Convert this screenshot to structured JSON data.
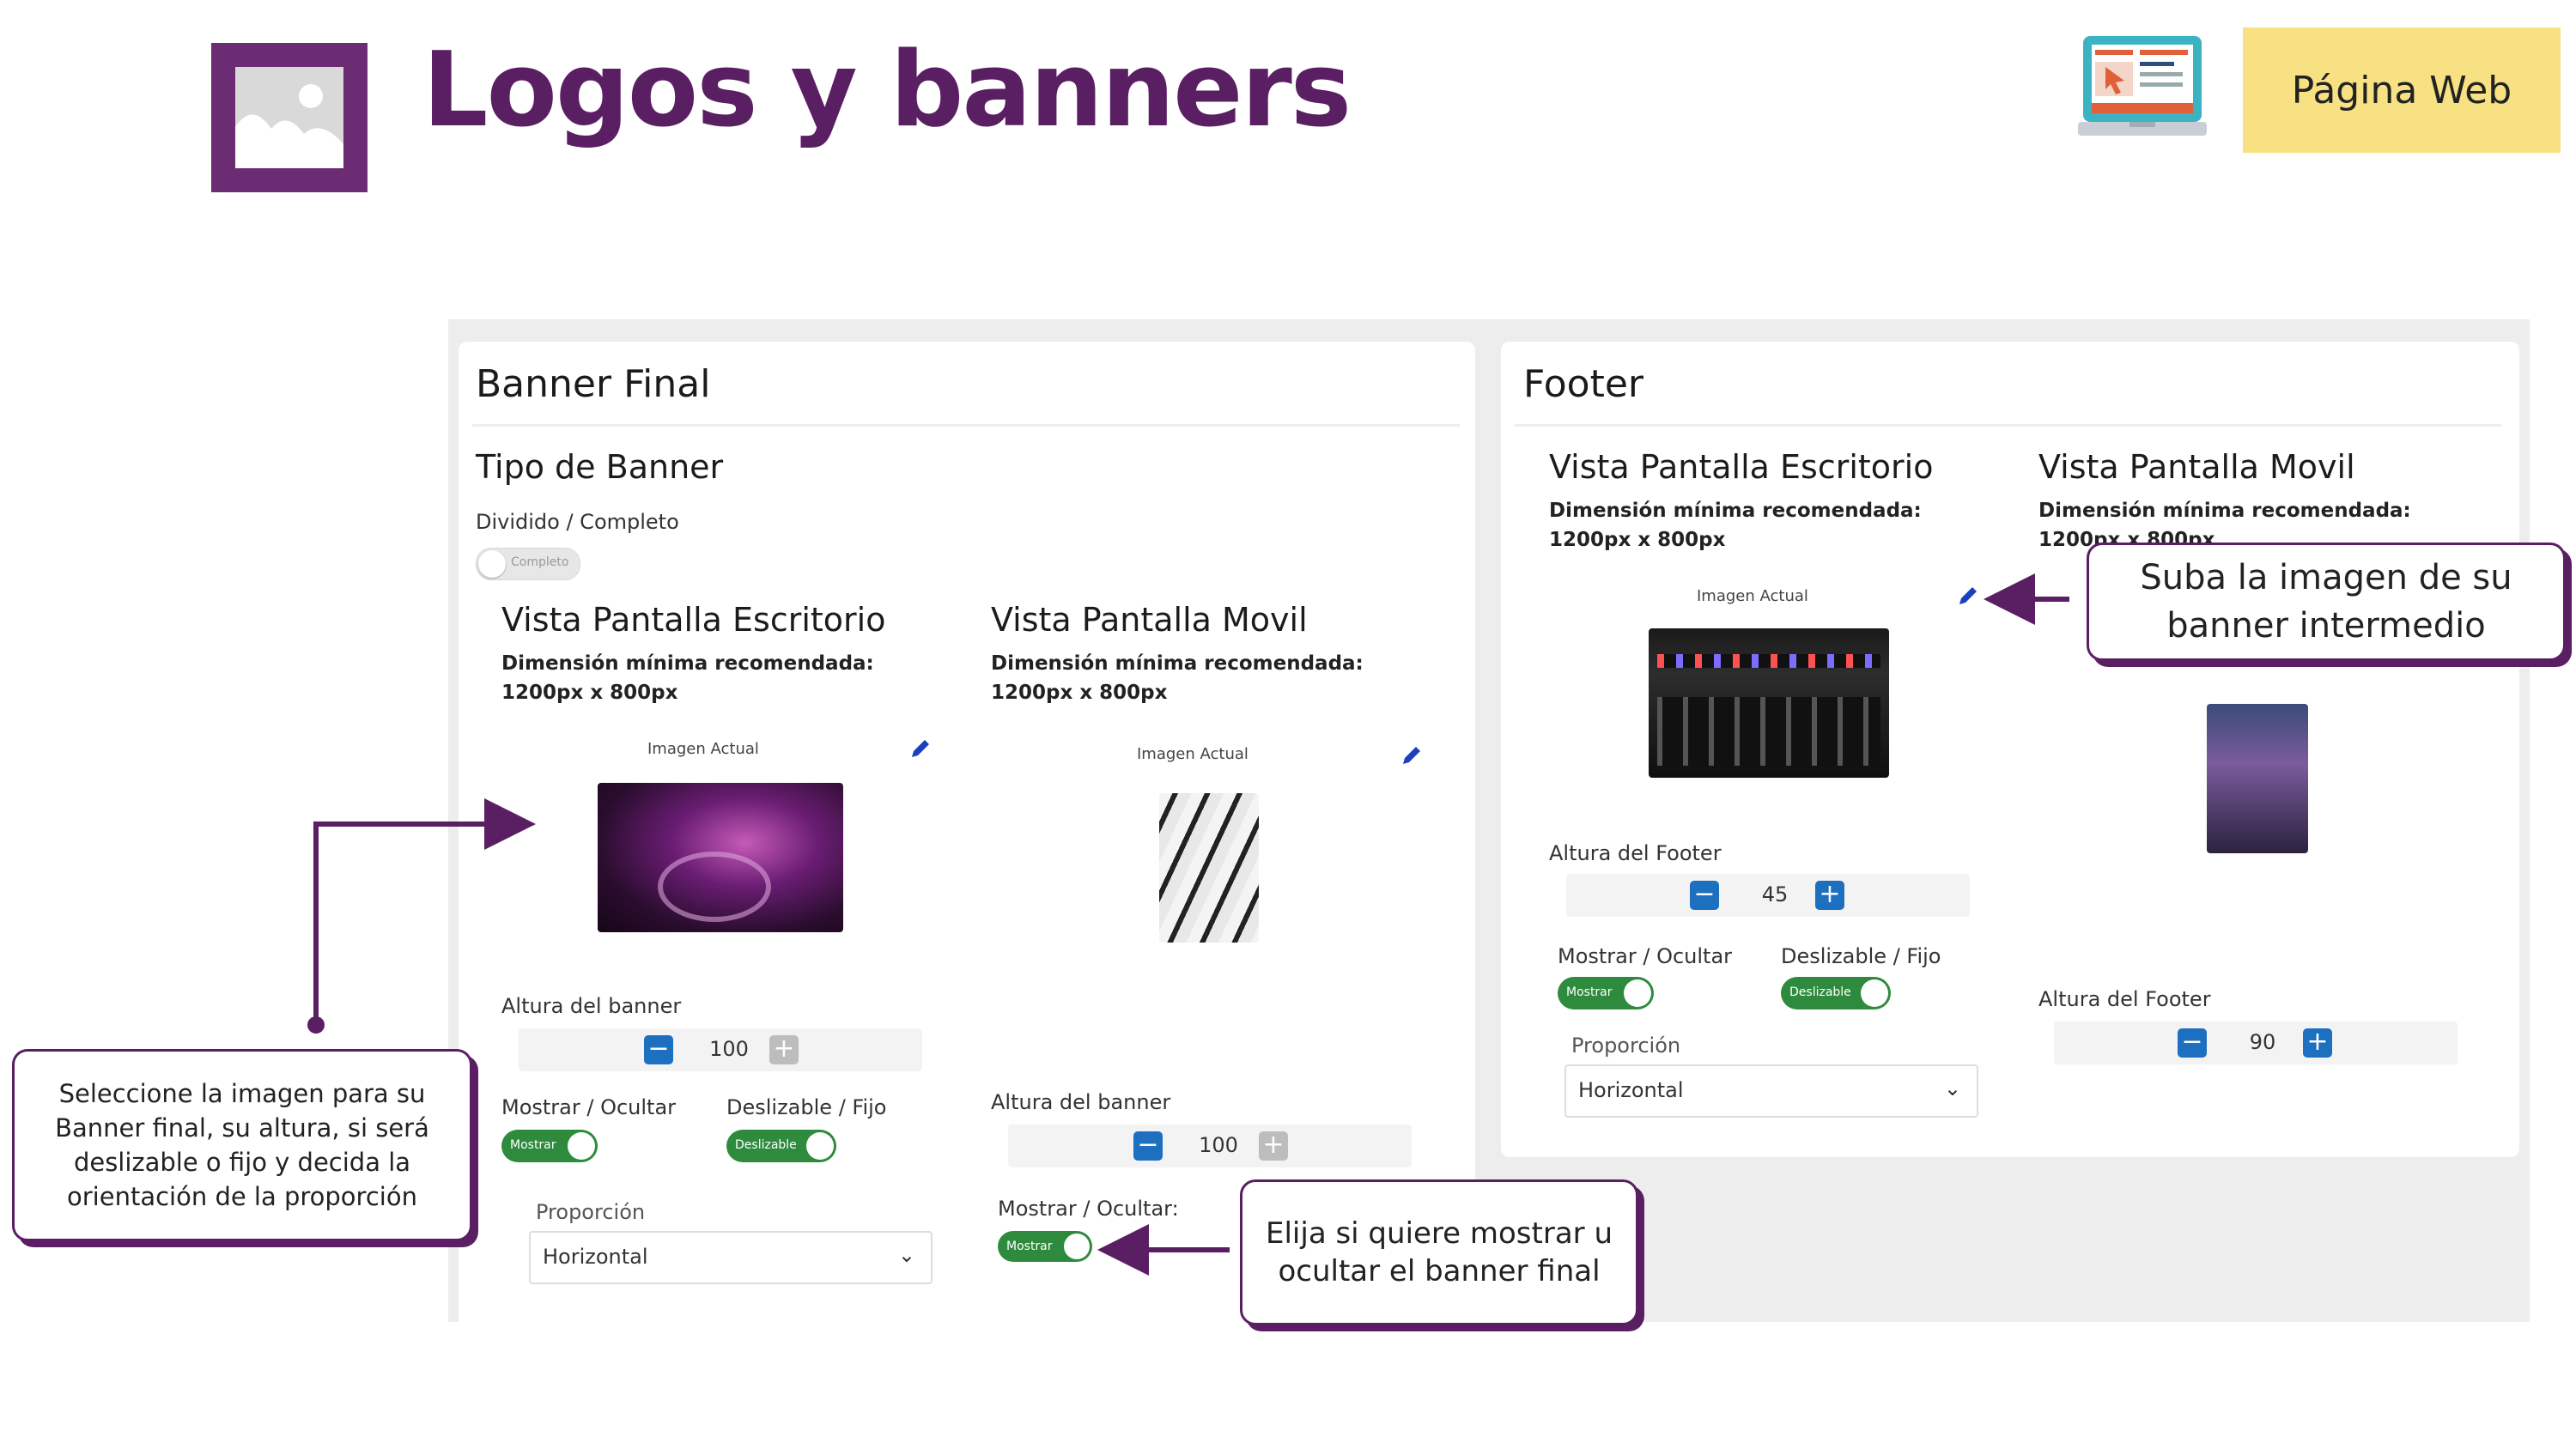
{
  "header": {
    "title": "Logos y banners",
    "badge": "Página Web",
    "image_icon": "image-icon",
    "laptop_icon": "laptop-webpage-icon"
  },
  "banner_final": {
    "title": "Banner Final",
    "tipo_title": "Tipo de Banner",
    "tipo_label": "Dividido / Completo",
    "tipo_toggle": "Completo",
    "desktop": {
      "title": "Vista Pantalla Escritorio",
      "dimension": "Dimensión mínima recomendada: 1200px x 800px",
      "image_label": "Imagen Actual",
      "altura_label": "Altura del banner",
      "altura_value": "100",
      "mostrar_label": "Mostrar / Ocultar",
      "mostrar_toggle": "Mostrar",
      "deslizable_label": "Deslizable / Fijo",
      "deslizable_toggle": "Deslizable",
      "proporcion_label": "Proporción",
      "proporcion_value": "Horizontal"
    },
    "mobile": {
      "title": "Vista Pantalla Movil",
      "dimension": "Dimensión mínima recomendada: 1200px x 800px",
      "image_label": "Imagen Actual",
      "altura_label": "Altura del banner",
      "altura_value": "100",
      "mostrar_label": "Mostrar / Ocultar:",
      "mostrar_toggle": "Mostrar"
    }
  },
  "footer": {
    "title": "Footer",
    "desktop": {
      "title": "Vista Pantalla Escritorio",
      "dimension": "Dimensión mínima recomendada: 1200px x 800px",
      "image_label": "Imagen Actual",
      "altura_label": "Altura del Footer",
      "altura_value": "45",
      "mostrar_label": "Mostrar / Ocultar",
      "mostrar_toggle": "Mostrar",
      "deslizable_label": "Deslizable / Fijo",
      "deslizable_toggle": "Deslizable",
      "proporcion_label": "Proporción",
      "proporcion_value": "Horizontal"
    },
    "mobile": {
      "title": "Vista Pantalla Movil",
      "dimension": "Dimensión mínima recomendada: 1200px x 800px",
      "altura_label": "Altura del Footer",
      "altura_value": "90"
    }
  },
  "callouts": {
    "left": "Seleccione la imagen para su Banner final, su altura, si será deslizable o fijo y decida la orientación de la proporción",
    "right": "Suba la imagen de su banner intermedio",
    "bottom": "Elija si quiere mostrar u ocultar el banner final"
  },
  "colors": {
    "brand": "#5a1f63",
    "badge": "#f8e183",
    "toggle_on": "#2e8b3e",
    "stepper_blue": "#1d6fc0"
  }
}
